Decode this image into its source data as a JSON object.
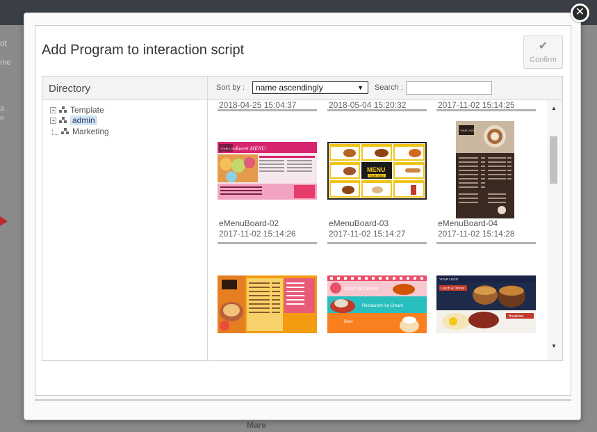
{
  "background": {
    "left_texts": [
      "ot",
      "me",
      "a",
      "e"
    ],
    "bottom_text": "Mare"
  },
  "modal": {
    "title": "Add Program to interaction script",
    "confirm_label": "Confirm",
    "close_label": "✕"
  },
  "directory": {
    "title": "Directory",
    "tree": [
      {
        "label": "Template",
        "expandable": true,
        "selected": false
      },
      {
        "label": "admin",
        "expandable": true,
        "selected": true
      },
      {
        "label": "Marketing",
        "expandable": false,
        "selected": false
      }
    ]
  },
  "toolbar": {
    "sort_label": "Sort by :",
    "sort_value": "name ascendingly",
    "search_label": "Search :",
    "search_value": ""
  },
  "programs": [
    {
      "name": "",
      "date": "2018-04-25 15:04:37"
    },
    {
      "name": "",
      "date": "2018-05-04 15:20:32"
    },
    {
      "name": "",
      "date": "2017-11-02 15:14:25"
    },
    {
      "name": "eMenuBoard-02",
      "date": "2017-11-02 15:14:26"
    },
    {
      "name": "eMenuBoard-03",
      "date": "2017-11-02 15:14:27"
    },
    {
      "name": "eMenuBoard-04",
      "date": "2017-11-02 15:14:28"
    }
  ],
  "thumb_texts": {
    "t1_logo": "YOUR LOGO",
    "t1_title": "Sweet MENU",
    "t2_title": "MENU",
    "t2_sub": "YOUR LOGO",
    "t5_title": "Lunch & Dinner",
    "t5_sub": "Restaurant Ice Cream",
    "t5_bottom": "Beer",
    "t6_logo": "YOUR LOGO",
    "t6_title": "Lunch & Dinner",
    "t6_sub": "Breakfast",
    "t4_logo": "YOUR LOGO"
  },
  "colors": {
    "accent_selected": "#cfe6f7",
    "close_bg": "#2a2a2a",
    "overlay_bg": "#8a8a8a"
  }
}
